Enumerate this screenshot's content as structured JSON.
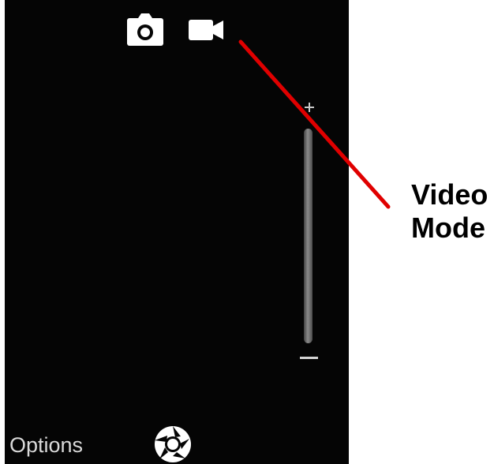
{
  "camera": {
    "mode_icons": [
      {
        "name": "camera-icon",
        "active": true
      },
      {
        "name": "video-camera-icon",
        "active": true
      }
    ],
    "controls": {
      "zoom_in_icon": "plus-icon",
      "zoom_out_icon": "minus-icon",
      "shutter_icon": "aperture-icon"
    },
    "options_label": "Options"
  },
  "annotation": {
    "label": "Video\nMode",
    "color": "#e00000"
  },
  "colors": {
    "screen_background": "#050505",
    "icon_color": "#ffffff",
    "text_color": "#d9d9d9"
  }
}
